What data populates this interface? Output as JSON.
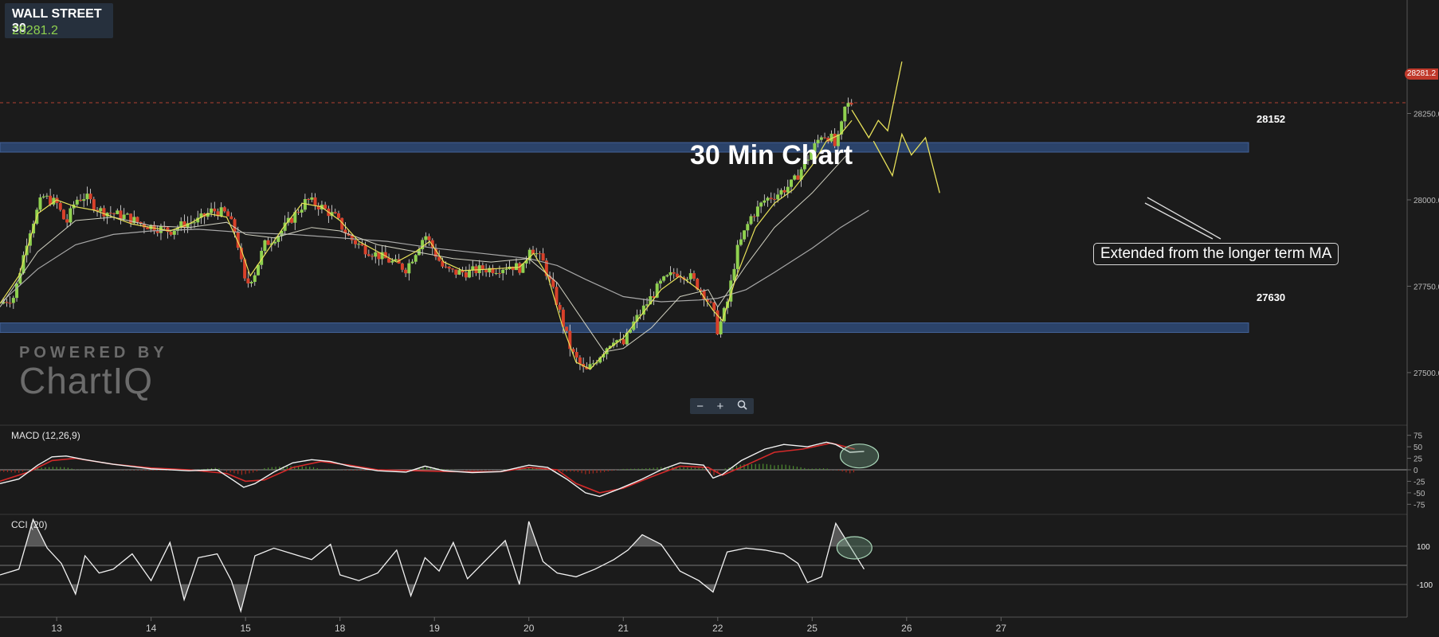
{
  "ticker": {
    "symbol": "WALL STREET 30",
    "price": "28281.2",
    "price_tag": "28281.2"
  },
  "title": "30 Min Chart",
  "annotation": "Extended from the longer term MA",
  "watermark": {
    "line1": "POWERED BY",
    "line2": "ChartIQ"
  },
  "zoom": {
    "minus": "−",
    "plus": "+",
    "zoom_icon": "magnifier-icon"
  },
  "levels": [
    {
      "value": 28152,
      "label": "28152"
    },
    {
      "value": 27630,
      "label": "27630"
    }
  ],
  "colors": {
    "bull": "#8fd14f",
    "bear": "#d9412a",
    "level_band": "#2e4a78",
    "macd_signal": "#d42a2a",
    "fast_ma": "#e8e25a"
  },
  "chart_data": [
    {
      "type": "candlestick",
      "name": "price",
      "ylim": [
        27380,
        28560
      ],
      "yticks": [
        27500,
        27750,
        28000,
        28250
      ],
      "ytick_labels": [
        "27500.0",
        "27750.0",
        "28000.0",
        "28250.0"
      ],
      "xlim": [
        12.4,
        27.3
      ],
      "xticks": [
        13,
        14,
        15,
        18,
        19,
        20,
        21,
        22,
        25,
        26,
        27
      ],
      "xtick_positions": [
        13,
        14,
        15,
        16,
        17,
        18,
        19,
        20,
        21,
        22,
        23
      ],
      "close_path": [
        [
          12.4,
          27700
        ],
        [
          12.55,
          27720
        ],
        [
          12.7,
          27900
        ],
        [
          12.85,
          28010
        ],
        [
          13.0,
          27990
        ],
        [
          13.1,
          27930
        ],
        [
          13.2,
          28000
        ],
        [
          13.3,
          28010
        ],
        [
          13.45,
          27970
        ],
        [
          13.6,
          27960
        ],
        [
          13.75,
          27950
        ],
        [
          13.9,
          27930
        ],
        [
          14.05,
          27920
        ],
        [
          14.2,
          27910
        ],
        [
          14.35,
          27930
        ],
        [
          14.5,
          27940
        ],
        [
          14.65,
          27970
        ],
        [
          14.8,
          27960
        ],
        [
          14.9,
          27900
        ],
        [
          15.0,
          27750
        ],
        [
          15.1,
          27790
        ],
        [
          15.2,
          27870
        ],
        [
          15.35,
          27900
        ],
        [
          15.5,
          27950
        ],
        [
          15.65,
          28000
        ],
        [
          15.8,
          27980
        ],
        [
          15.95,
          27950
        ],
        [
          16.0,
          27930
        ],
        [
          16.1,
          27890
        ],
        [
          16.25,
          27860
        ],
        [
          16.4,
          27840
        ],
        [
          16.55,
          27820
        ],
        [
          16.7,
          27800
        ],
        [
          16.8,
          27850
        ],
        [
          16.9,
          27900
        ],
        [
          17.0,
          27850
        ],
        [
          17.1,
          27800
        ],
        [
          17.2,
          27790
        ],
        [
          17.35,
          27790
        ],
        [
          17.5,
          27800
        ],
        [
          17.65,
          27800
        ],
        [
          17.8,
          27810
        ],
        [
          17.95,
          27800
        ],
        [
          18.0,
          27870
        ],
        [
          18.15,
          27820
        ],
        [
          18.3,
          27700
        ],
        [
          18.45,
          27560
        ],
        [
          18.6,
          27500
        ],
        [
          18.75,
          27550
        ],
        [
          18.9,
          27600
        ],
        [
          19.0,
          27580
        ],
        [
          19.1,
          27640
        ],
        [
          19.25,
          27700
        ],
        [
          19.4,
          27760
        ],
        [
          19.55,
          27790
        ],
        [
          19.7,
          27780
        ],
        [
          19.85,
          27730
        ],
        [
          19.95,
          27680
        ],
        [
          20.0,
          27620
        ],
        [
          20.1,
          27700
        ],
        [
          20.2,
          27850
        ],
        [
          20.35,
          27950
        ],
        [
          20.5,
          28000
        ],
        [
          20.65,
          28020
        ],
        [
          20.8,
          28050
        ],
        [
          20.95,
          28120
        ],
        [
          21.1,
          28190
        ],
        [
          21.2,
          28180
        ],
        [
          21.25,
          28150
        ],
        [
          21.3,
          28200
        ],
        [
          21.35,
          28270
        ],
        [
          21.42,
          28281
        ]
      ],
      "fast_ma_path": [
        [
          12.4,
          27700
        ],
        [
          12.6,
          27780
        ],
        [
          12.8,
          27960
        ],
        [
          13.0,
          28000
        ],
        [
          13.2,
          27980
        ],
        [
          13.4,
          27970
        ],
        [
          13.6,
          27950
        ],
        [
          13.8,
          27930
        ],
        [
          14.0,
          27920
        ],
        [
          14.2,
          27910
        ],
        [
          14.4,
          27930
        ],
        [
          14.6,
          27960
        ],
        [
          14.8,
          27950
        ],
        [
          14.95,
          27860
        ],
        [
          15.05,
          27780
        ],
        [
          15.2,
          27840
        ],
        [
          15.4,
          27920
        ],
        [
          15.6,
          27990
        ],
        [
          15.8,
          27980
        ],
        [
          16.0,
          27940
        ],
        [
          16.2,
          27880
        ],
        [
          16.4,
          27850
        ],
        [
          16.6,
          27820
        ],
        [
          16.8,
          27850
        ],
        [
          16.95,
          27880
        ],
        [
          17.1,
          27820
        ],
        [
          17.3,
          27795
        ],
        [
          17.6,
          27800
        ],
        [
          17.9,
          27805
        ],
        [
          18.05,
          27845
        ],
        [
          18.2,
          27780
        ],
        [
          18.35,
          27640
        ],
        [
          18.5,
          27530
        ],
        [
          18.65,
          27510
        ],
        [
          18.85,
          27570
        ],
        [
          19.0,
          27600
        ],
        [
          19.2,
          27670
        ],
        [
          19.4,
          27740
        ],
        [
          19.6,
          27780
        ],
        [
          19.8,
          27740
        ],
        [
          19.95,
          27680
        ],
        [
          20.05,
          27650
        ],
        [
          20.2,
          27780
        ],
        [
          20.4,
          27920
        ],
        [
          20.6,
          27990
        ],
        [
          20.8,
          28030
        ],
        [
          21.0,
          28100
        ],
        [
          21.15,
          28170
        ],
        [
          21.3,
          28190
        ],
        [
          21.42,
          28230
        ]
      ],
      "slow_ma_path": [
        [
          12.4,
          27690
        ],
        [
          12.8,
          27850
        ],
        [
          13.2,
          27940
        ],
        [
          13.6,
          27950
        ],
        [
          14.0,
          27925
        ],
        [
          14.4,
          27920
        ],
        [
          14.8,
          27935
        ],
        [
          15.0,
          27900
        ],
        [
          15.3,
          27890
        ],
        [
          15.7,
          27920
        ],
        [
          16.0,
          27910
        ],
        [
          16.4,
          27870
        ],
        [
          16.8,
          27850
        ],
        [
          17.2,
          27830
        ],
        [
          17.6,
          27820
        ],
        [
          18.0,
          27830
        ],
        [
          18.3,
          27760
        ],
        [
          18.6,
          27640
        ],
        [
          18.8,
          27560
        ],
        [
          19.0,
          27570
        ],
        [
          19.3,
          27630
        ],
        [
          19.6,
          27720
        ],
        [
          19.9,
          27740
        ],
        [
          20.0,
          27690
        ],
        [
          20.3,
          27810
        ],
        [
          20.6,
          27920
        ],
        [
          21.0,
          28020
        ],
        [
          21.4,
          28140
        ]
      ],
      "long_ma_path": [
        [
          12.4,
          27700
        ],
        [
          12.8,
          27800
        ],
        [
          13.2,
          27870
        ],
        [
          13.6,
          27900
        ],
        [
          14.0,
          27910
        ],
        [
          14.5,
          27915
        ],
        [
          15.0,
          27905
        ],
        [
          15.5,
          27900
        ],
        [
          16.0,
          27890
        ],
        [
          16.5,
          27880
        ],
        [
          17.0,
          27860
        ],
        [
          17.5,
          27845
        ],
        [
          18.0,
          27830
        ],
        [
          18.3,
          27810
        ],
        [
          18.6,
          27770
        ],
        [
          19.0,
          27720
        ],
        [
          19.4,
          27705
        ],
        [
          19.8,
          27710
        ],
        [
          20.0,
          27715
        ],
        [
          20.3,
          27740
        ],
        [
          20.6,
          27790
        ],
        [
          21.0,
          27860
        ],
        [
          21.3,
          27920
        ],
        [
          21.6,
          27970
        ]
      ],
      "projection_up": [
        [
          21.42,
          28260
        ],
        [
          21.6,
          28180
        ],
        [
          21.7,
          28230
        ],
        [
          21.8,
          28200
        ],
        [
          21.95,
          28400
        ]
      ],
      "projection_down": [
        [
          21.65,
          28170
        ],
        [
          21.85,
          28070
        ],
        [
          21.95,
          28190
        ],
        [
          22.05,
          28130
        ],
        [
          22.2,
          28180
        ],
        [
          22.35,
          28020
        ]
      ]
    },
    {
      "type": "line",
      "name": "MACD (12,26,9)",
      "ylim": [
        -90,
        90
      ],
      "yticks": [
        75,
        50,
        25,
        0,
        -25,
        -50,
        -75
      ],
      "ytick_labels": [
        "75",
        "50",
        "25",
        "0",
        "-25",
        "-50",
        "-75"
      ],
      "macd_path": [
        [
          12.4,
          -30
        ],
        [
          12.6,
          -20
        ],
        [
          12.8,
          10
        ],
        [
          12.95,
          28
        ],
        [
          13.1,
          30
        ],
        [
          13.3,
          22
        ],
        [
          13.6,
          12
        ],
        [
          14.0,
          2
        ],
        [
          14.4,
          -2
        ],
        [
          14.7,
          0
        ],
        [
          14.85,
          -20
        ],
        [
          14.98,
          -38
        ],
        [
          15.1,
          -30
        ],
        [
          15.3,
          -5
        ],
        [
          15.5,
          15
        ],
        [
          15.7,
          22
        ],
        [
          15.9,
          18
        ],
        [
          16.1,
          8
        ],
        [
          16.4,
          -2
        ],
        [
          16.7,
          -5
        ],
        [
          16.9,
          8
        ],
        [
          17.1,
          -2
        ],
        [
          17.4,
          -6
        ],
        [
          17.7,
          -4
        ],
        [
          18.0,
          10
        ],
        [
          18.2,
          5
        ],
        [
          18.4,
          -20
        ],
        [
          18.6,
          -50
        ],
        [
          18.75,
          -58
        ],
        [
          18.95,
          -42
        ],
        [
          19.2,
          -20
        ],
        [
          19.4,
          0
        ],
        [
          19.6,
          15
        ],
        [
          19.85,
          10
        ],
        [
          19.95,
          -18
        ],
        [
          20.05,
          -10
        ],
        [
          20.25,
          20
        ],
        [
          20.5,
          45
        ],
        [
          20.7,
          55
        ],
        [
          20.95,
          50
        ],
        [
          21.15,
          60
        ],
        [
          21.25,
          55
        ],
        [
          21.4,
          38
        ],
        [
          21.55,
          40
        ]
      ],
      "signal_path": [
        [
          12.4,
          -25
        ],
        [
          12.7,
          -5
        ],
        [
          12.95,
          20
        ],
        [
          13.2,
          25
        ],
        [
          13.6,
          12
        ],
        [
          14.0,
          4
        ],
        [
          14.4,
          0
        ],
        [
          14.8,
          -8
        ],
        [
          15.0,
          -25
        ],
        [
          15.2,
          -22
        ],
        [
          15.5,
          5
        ],
        [
          15.8,
          18
        ],
        [
          16.1,
          10
        ],
        [
          16.4,
          0
        ],
        [
          16.8,
          -2
        ],
        [
          17.2,
          -4
        ],
        [
          17.7,
          -4
        ],
        [
          18.0,
          5
        ],
        [
          18.3,
          0
        ],
        [
          18.5,
          -30
        ],
        [
          18.75,
          -50
        ],
        [
          19.0,
          -40
        ],
        [
          19.3,
          -15
        ],
        [
          19.6,
          8
        ],
        [
          19.9,
          5
        ],
        [
          20.05,
          -12
        ],
        [
          20.3,
          10
        ],
        [
          20.6,
          38
        ],
        [
          20.9,
          45
        ],
        [
          21.2,
          58
        ],
        [
          21.45,
          45
        ]
      ],
      "highlight_x": 21.5
    },
    {
      "type": "area",
      "name": "CCI (20)",
      "ylim": [
        -250,
        250
      ],
      "yticks": [
        100,
        -100
      ],
      "ytick_labels": [
        "100",
        "-100"
      ],
      "cci_path": [
        [
          12.4,
          -50
        ],
        [
          12.6,
          -20
        ],
        [
          12.75,
          240
        ],
        [
          12.9,
          90
        ],
        [
          13.05,
          10
        ],
        [
          13.2,
          -150
        ],
        [
          13.3,
          50
        ],
        [
          13.45,
          -40
        ],
        [
          13.6,
          -20
        ],
        [
          13.8,
          60
        ],
        [
          14.0,
          -80
        ],
        [
          14.2,
          120
        ],
        [
          14.35,
          -180
        ],
        [
          14.5,
          40
        ],
        [
          14.7,
          60
        ],
        [
          14.85,
          -80
        ],
        [
          14.95,
          -240
        ],
        [
          15.1,
          50
        ],
        [
          15.3,
          90
        ],
        [
          15.5,
          60
        ],
        [
          15.7,
          30
        ],
        [
          15.9,
          110
        ],
        [
          16.0,
          -50
        ],
        [
          16.2,
          -80
        ],
        [
          16.4,
          -40
        ],
        [
          16.6,
          80
        ],
        [
          16.75,
          -160
        ],
        [
          16.9,
          40
        ],
        [
          17.05,
          -30
        ],
        [
          17.2,
          120
        ],
        [
          17.35,
          -70
        ],
        [
          17.55,
          30
        ],
        [
          17.75,
          130
        ],
        [
          17.9,
          -100
        ],
        [
          18.0,
          230
        ],
        [
          18.15,
          20
        ],
        [
          18.3,
          -40
        ],
        [
          18.5,
          -60
        ],
        [
          18.7,
          -20
        ],
        [
          18.9,
          30
        ],
        [
          19.05,
          80
        ],
        [
          19.2,
          160
        ],
        [
          19.4,
          110
        ],
        [
          19.6,
          -30
        ],
        [
          19.8,
          -80
        ],
        [
          19.95,
          -140
        ],
        [
          20.1,
          70
        ],
        [
          20.3,
          90
        ],
        [
          20.5,
          80
        ],
        [
          20.7,
          60
        ],
        [
          20.85,
          10
        ],
        [
          20.95,
          -90
        ],
        [
          21.1,
          -60
        ],
        [
          21.25,
          220
        ],
        [
          21.4,
          100
        ],
        [
          21.55,
          -20
        ]
      ],
      "highlight_x": 21.38
    }
  ]
}
